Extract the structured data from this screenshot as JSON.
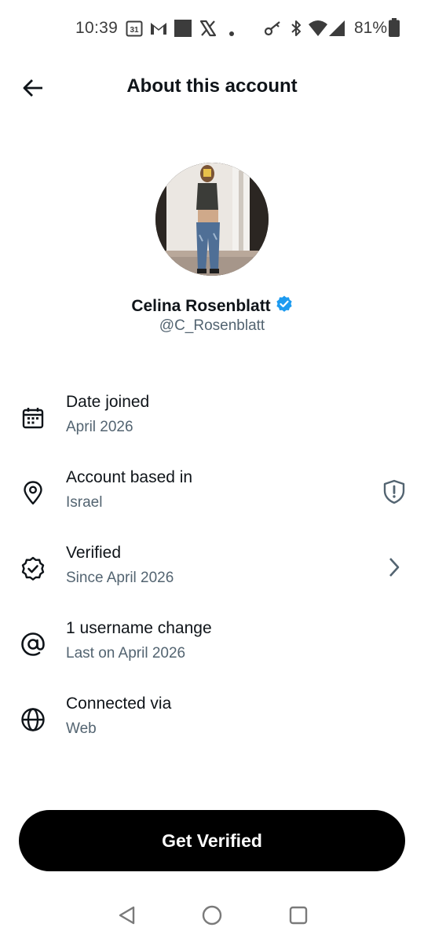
{
  "status_bar": {
    "time": "10:39",
    "calendar_day": "31",
    "battery_percent": "81%",
    "left_icons": [
      "calendar-icon",
      "gmail-icon",
      "square-app-icon",
      "x-app-icon",
      "dot-icon"
    ],
    "right_icons": [
      "key-icon",
      "bluetooth-icon",
      "wifi-icon",
      "cell-signal-icon",
      "battery-icon"
    ]
  },
  "header": {
    "title": "About this account"
  },
  "profile": {
    "display_name": "Celina Rosenblatt",
    "handle": "@C_Rosenblatt",
    "verified": true,
    "verified_color": "#1d9bf0"
  },
  "info_items": [
    {
      "icon": "calendar-icon",
      "title": "Date joined",
      "subtitle": "April 2026"
    },
    {
      "icon": "location-pin-icon",
      "title": "Account based in",
      "subtitle": "Israel",
      "trailing": "shield-alert-icon"
    },
    {
      "icon": "verified-badge-icon",
      "title": "Verified",
      "subtitle": "Since April 2026",
      "trailing": "chevron-right-icon"
    },
    {
      "icon": "at-sign-icon",
      "title": "1 username change",
      "subtitle": "Last on April 2026"
    },
    {
      "icon": "globe-icon",
      "title": "Connected via",
      "subtitle": "Web"
    }
  ],
  "cta": {
    "label": "Get Verified"
  },
  "nav_bar": {
    "buttons": [
      "back-triangle-icon",
      "home-circle-icon",
      "recents-square-icon"
    ]
  },
  "colors": {
    "text_primary": "#0f1419",
    "text_secondary": "#536471",
    "button_bg": "#000000",
    "button_text": "#ffffff"
  }
}
